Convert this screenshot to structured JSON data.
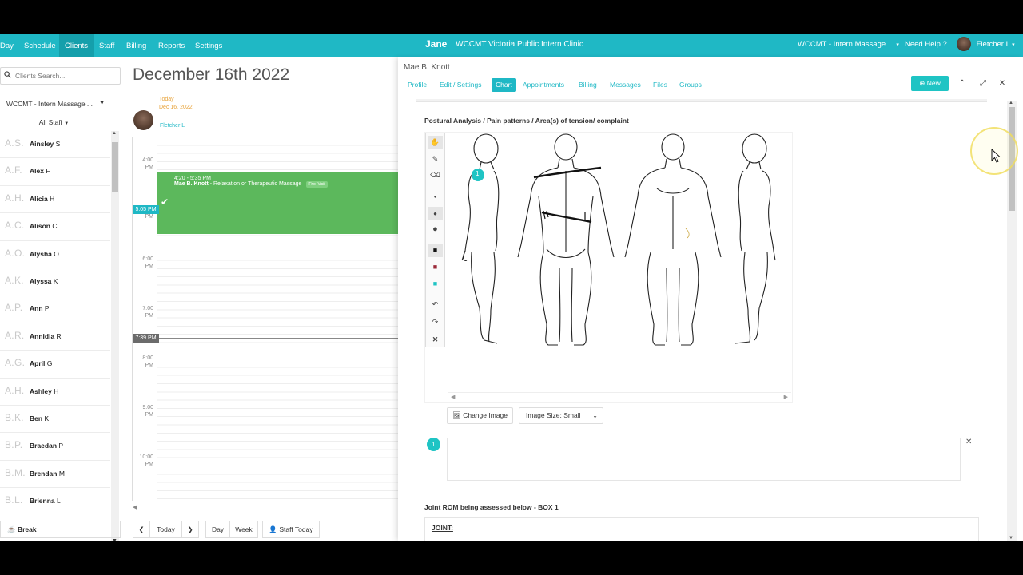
{
  "nav": {
    "items": [
      "Day",
      "Schedule",
      "Clients",
      "Staff",
      "Billing",
      "Reports",
      "Settings"
    ],
    "active": "Clients",
    "brand": "WCCMT Victoria Public Intern Clinic",
    "logo": "Jane",
    "location": "WCCMT - Intern Massage ...",
    "help": "Need Help ?",
    "user": "Fletcher L"
  },
  "staff_panel": {
    "search_placeholder": "Clients Search...",
    "clinic": "WCCMT - Intern Massage ...",
    "filter": "All Staff",
    "staff": [
      {
        "initials": "A.S.",
        "first": "Ainsley",
        "last": "S"
      },
      {
        "initials": "A.F.",
        "first": "Alex",
        "last": "F"
      },
      {
        "initials": "A.H.",
        "first": "Alicia",
        "last": "H"
      },
      {
        "initials": "A.C.",
        "first": "Alison",
        "last": "C"
      },
      {
        "initials": "A.O.",
        "first": "Alysha",
        "last": "O"
      },
      {
        "initials": "A.K.",
        "first": "Alyssa",
        "last": "K"
      },
      {
        "initials": "A.P.",
        "first": "Ann",
        "last": "P"
      },
      {
        "initials": "A.R.",
        "first": "Annidia",
        "last": "R"
      },
      {
        "initials": "A.G.",
        "first": "April",
        "last": "G"
      },
      {
        "initials": "A.H.",
        "first": "Ashley",
        "last": "H"
      },
      {
        "initials": "B.K.",
        "first": "Ben",
        "last": "K"
      },
      {
        "initials": "B.P.",
        "first": "Braedan",
        "last": "P"
      },
      {
        "initials": "B.M.",
        "first": "Brendan",
        "last": "M"
      },
      {
        "initials": "B.L.",
        "first": "Brienna",
        "last": "L"
      }
    ],
    "break_label": "Break"
  },
  "calendar": {
    "title": "December 16th 2022",
    "today_label": "Today",
    "date_label": "Dec 16, 2022",
    "staff_name": "Fletcher L",
    "hours": [
      {
        "h": "4:00",
        "p": "PM"
      },
      {
        "h": "5:00",
        "p": "PM"
      },
      {
        "h": "6:00",
        "p": "PM"
      },
      {
        "h": "7:00",
        "p": "PM"
      },
      {
        "h": "8:00",
        "p": "PM"
      },
      {
        "h": "9:00",
        "p": "PM"
      },
      {
        "h": "10:00",
        "p": "PM"
      }
    ],
    "now_badge": "5:05 PM",
    "current_badge": "7:39 PM",
    "appointment": {
      "time": "4:20 - 5:35 PM",
      "client": "Mae B. Knott",
      "service": " - Relaxation or Therapeutic Massage",
      "tag": "First Visit"
    },
    "toolbar": {
      "today": "Today",
      "day": "Day",
      "week": "Week",
      "staff_today": "Staff Today"
    }
  },
  "client": {
    "name": "Mae B. Knott",
    "tabs": [
      "Profile",
      "Edit / Settings",
      "Chart",
      "Appointments",
      "Billing",
      "Messages",
      "Files",
      "Groups"
    ],
    "active_tab": "Chart",
    "new_label": "New",
    "postural_title": "Postural Analysis / Pain patterns / Area(s) of tension/ complaint",
    "marker_number": "1",
    "change_image": "Change Image",
    "image_size": "Image Size: Small",
    "joint_title": "Joint ROM being assessed below - BOX 1",
    "joint_label": "JOINT:"
  },
  "colors": {
    "accent": "#1fb8c5",
    "appointment": "#5cb85c",
    "today": "#e8a33a"
  }
}
